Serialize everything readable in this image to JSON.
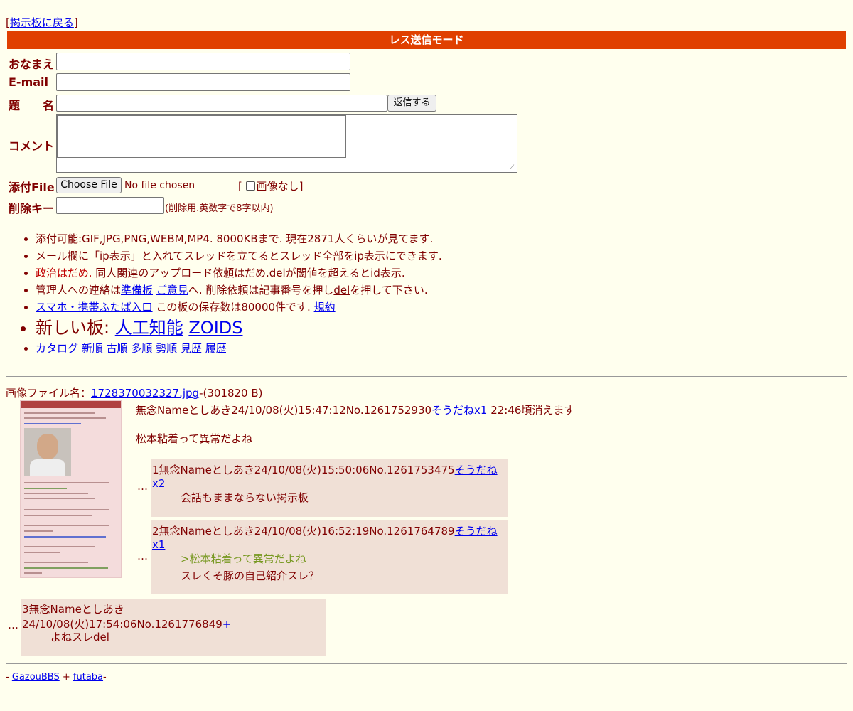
{
  "nav": {
    "back_open": "[",
    "back_label": "掲示板に戻る",
    "back_close": "]"
  },
  "mode_title": "レス送信モード",
  "form": {
    "name_label": "おなまえ",
    "email_label": "E-mail",
    "subject_label": "題　　名",
    "submit_label": "返信する",
    "comment_label": "コメント",
    "file_label": "添付File",
    "choose_file_label": "Choose File",
    "no_file_text": "No file chosen",
    "noimage_open": "[",
    "noimage_label": "画像なし",
    "noimage_close": "]",
    "delete_key_label": "削除キー",
    "delete_key_note": "(削除用.英数字で8字以内)"
  },
  "rules": {
    "r1": "添付可能:GIF,JPG,PNG,WEBM,MP4. 8000KBまで. 現在2871人くらいが見てます.",
    "r2": "メール欄に「ip表示」と入れてスレッドを立てるとスレッド全部をip表示にできます.",
    "r3_red": "政治はだめ.",
    "r3_rest": " 同人関連のアップロード依頼はだめ.delが閾値を超えるとid表示.",
    "r4_a": "管理人への連絡は",
    "r4_link1": "準備板",
    "r4_link2": "ご意見",
    "r4_b": "へ. 削除依頼は記事番号を押し",
    "r4_del": "del",
    "r4_c": "を押して下さい.",
    "r5_link": "スマホ・携帯ふたば入口",
    "r5_text": " この板の保存数は80000件です. ",
    "r5_link2": "規約",
    "r6_text": "新しい板: ",
    "r6_link1": "人工知能",
    "r6_link2": "ZOIDS",
    "sort_links": [
      "カタログ",
      "新順",
      "古順",
      "多順",
      "勢順",
      "見歴",
      "履歴"
    ]
  },
  "thread": {
    "file_prefix": "画像ファイル名：",
    "file_name": "1728370032327.jpg",
    "file_size": "-(301820 B)",
    "op_header": "無念Nameとしあき24/10/08(火)15:47:12No.1261752930",
    "op_soudane": "そうだねx1",
    "op_expire": " 22:46頃消えます",
    "op_body": "松本粘着って異常だよね",
    "replies": [
      {
        "header": "1無念Nameとしあき24/10/08(火)15:50:06No.1261753475",
        "soudane": "そうだねx2",
        "body": "会話もままならない掲示板"
      },
      {
        "header": "2無念Nameとしあき24/10/08(火)16:52:19No.1261764789",
        "soudane": "そうだねx1",
        "quote": ">松本粘着って異常だよね",
        "body": "スレくそ豚の自己紹介スレ？"
      },
      {
        "header": "3無念Nameとしあき24/10/08(火)17:54:06No.1261776849",
        "soudane": "+",
        "body": "よねスレdel"
      }
    ],
    "dots": "…"
  },
  "footer": {
    "prefix": "- ",
    "link1": "GazouBBS",
    "sep": " + ",
    "link2": "futaba",
    "suffix": "-"
  },
  "colors": {
    "background": "#ffffee",
    "text": "#800000",
    "mode_bar": "#e04000",
    "reply_bg": "#f0e0d6",
    "quote": "#789922",
    "link": "#0000ee",
    "notice_red": "#c00000"
  }
}
